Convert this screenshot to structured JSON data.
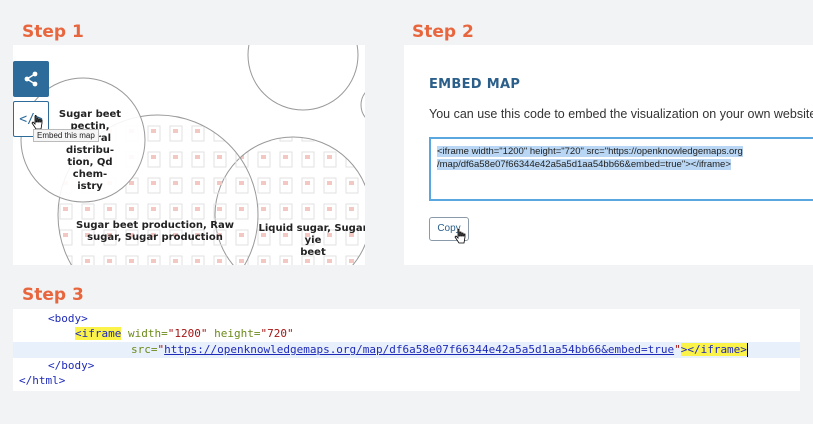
{
  "steps": {
    "step1": "Step 1",
    "step2": "Step 2",
    "step3": "Step 3"
  },
  "step1": {
    "tooltip": "Embed this map",
    "embed_button_glyph": "</>",
    "bubbles": {
      "b1": [
        "Sugar beet",
        "pectin, Neutral",
        "distribu-",
        "tion, Qd chem-",
        "istry"
      ],
      "b2": [
        "Sugar beet production, Raw",
        "sugar, Sugar production"
      ],
      "b3": [
        "Liquid sugar, Sugar yie",
        "beet"
      ]
    }
  },
  "step2": {
    "title": "EMBED MAP",
    "description": "You can use this code to embed the visualization on your own website or in a d",
    "code_line1": "<iframe width=\"1200\" height=\"720\" src=\"https://openknowledgemaps.org",
    "code_line2": "/map/df6a58e07f66344e42a5a5d1aa54bb66&embed=true\"></iframe>",
    "copy_label": "Copy"
  },
  "step3": {
    "body_open": "<body>",
    "iframe_open": "<iframe",
    "width_attr": "width=",
    "width_val": "\"1200\"",
    "height_attr": "height=",
    "height_val": "\"720\"",
    "src_attr": "src=",
    "src_q": "\"",
    "src_url": "https://openknowledgemaps.org/map/df6a58e07f66344e42a5a5d1aa54bb66",
    "src_amp": "&",
    "src_rest": "embed=true",
    "close_frag": "></iframe>",
    "body_close": "</body>",
    "html_close": "</html>"
  },
  "colors": {
    "step_label": "#e8663d",
    "accent": "#2d6b9a",
    "highlight_yellow": "#fbf24a"
  }
}
